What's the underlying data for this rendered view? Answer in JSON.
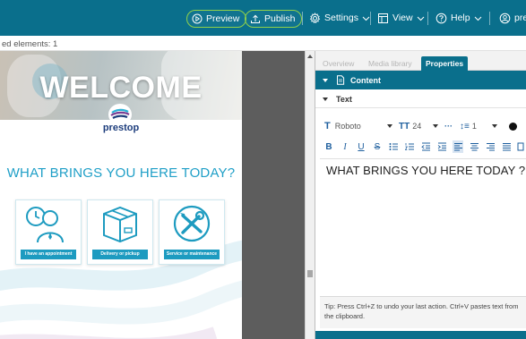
{
  "toolbar": {
    "preview_label": "Preview",
    "publish_label": "Publish",
    "settings_label": "Settings",
    "view_label": "View",
    "help_label": "Help",
    "user_label": "pre",
    "accent_color": "#0a6f8c",
    "pill_border_color": "#8fd14a"
  },
  "status": {
    "selected_text": "ed elements: 1"
  },
  "canvas": {
    "welcome_title": "WELCOME",
    "logo_text": "prestop",
    "question": "WHAT BRINGS YOU HERE TODAY?",
    "cards": [
      {
        "label": "I have an appointment",
        "icon": "person-clock-icon"
      },
      {
        "label": "Delivery or pickup",
        "icon": "box-icon"
      },
      {
        "label": "Service or maintenance",
        "icon": "tools-icon"
      }
    ]
  },
  "panel": {
    "tabs": [
      {
        "label": "Overview",
        "active": false
      },
      {
        "label": "Media library",
        "active": false
      },
      {
        "label": "Properties",
        "active": true
      }
    ],
    "content_header": "Content",
    "text_header": "Text",
    "font_name": "Roboto",
    "font_size": "24",
    "more": "···",
    "line_spacing": "1",
    "editor_text": "WHAT BRINGS YOU HERE TODAY ?",
    "tip_line1": "Tip: Press Ctrl+Z to undo your last action. Ctrl+V pastes text from",
    "tip_line2": "the clipboard."
  }
}
